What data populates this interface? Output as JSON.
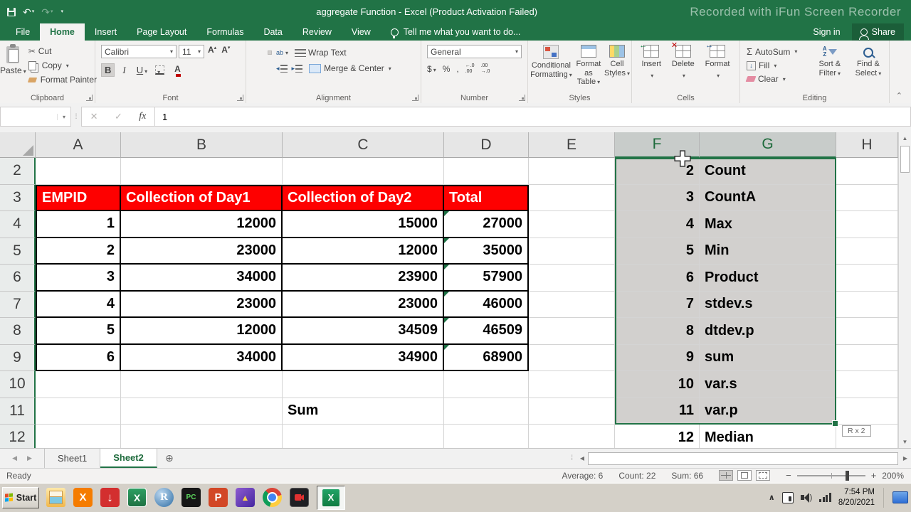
{
  "titlebar": {
    "title": "aggregate Function - Excel (Product Activation Failed)",
    "watermark": "Recorded with iFun Screen Recorder"
  },
  "menu": {
    "tabs": [
      "File",
      "Home",
      "Insert",
      "Page Layout",
      "Formulas",
      "Data",
      "Review",
      "View"
    ],
    "active_tab": "Home",
    "tell_me": "Tell me what you want to do...",
    "sign_in": "Sign in",
    "share": "Share"
  },
  "ribbon": {
    "clipboard": {
      "label": "Clipboard",
      "paste": "Paste",
      "cut": "Cut",
      "copy": "Copy",
      "format_painter": "Format Painter"
    },
    "font": {
      "label": "Font",
      "font_name": "Calibri",
      "font_size": "11"
    },
    "alignment": {
      "label": "Alignment",
      "wrap_text": "Wrap Text",
      "merge_center": "Merge & Center"
    },
    "number": {
      "label": "Number",
      "format": "General"
    },
    "styles": {
      "label": "Styles",
      "conditional": "Conditional Formatting",
      "format_table": "Format as Table",
      "cell_styles": "Cell Styles"
    },
    "cells": {
      "label": "Cells",
      "insert": "Insert",
      "delete": "Delete",
      "format": "Format"
    },
    "editing": {
      "label": "Editing",
      "autosum": "AutoSum",
      "fill": "Fill",
      "clear": "Clear",
      "sort_filter": "Sort & Filter",
      "find_select": "Find & Select"
    }
  },
  "formula_bar": {
    "name_box": "",
    "value": "1"
  },
  "grid": {
    "columns": [
      "A",
      "B",
      "C",
      "D",
      "E",
      "F",
      "G",
      "H"
    ],
    "selected_columns": [
      "F",
      "G"
    ],
    "first_row": 2,
    "last_row": 12,
    "table": {
      "headers": [
        "EMPID",
        "Collection of Day1",
        "Collection of Day2",
        "Total"
      ],
      "rows": [
        [
          "1",
          "12000",
          "15000",
          "27000"
        ],
        [
          "2",
          "23000",
          "12000",
          "35000"
        ],
        [
          "3",
          "34000",
          "23900",
          "57900"
        ],
        [
          "4",
          "23000",
          "23000",
          "46000"
        ],
        [
          "5",
          "12000",
          "34509",
          "46509"
        ],
        [
          "6",
          "34000",
          "34900",
          "68900"
        ]
      ]
    },
    "sum_label": "Sum",
    "fg_list": {
      "numbers": [
        "2",
        "3",
        "4",
        "5",
        "6",
        "7",
        "8",
        "9",
        "10",
        "11",
        "12"
      ],
      "names": [
        "Count",
        "CountA",
        "Max",
        "Min",
        "Product",
        "stdev.s",
        "dtdev.p",
        "sum",
        "var.s",
        "var.p",
        "Median"
      ]
    },
    "selection_tooltip": "R x 2"
  },
  "sheet_bar": {
    "sheets": [
      "Sheet1",
      "Sheet2"
    ],
    "active": "Sheet2"
  },
  "status_bar": {
    "mode": "Ready",
    "average": "Average: 6",
    "count": "Count: 22",
    "sum": "Sum: 66",
    "zoom": "200%"
  },
  "taskbar": {
    "start": "Start",
    "icons": [
      "explorer",
      "xampp",
      "download-manager",
      "excel-old",
      "r",
      "pycharm",
      "powerpoint",
      "photo-app",
      "chrome",
      "screen-recorder"
    ],
    "active_app": "excel",
    "tray_time": "7:54 PM",
    "tray_date": "8/20/2021"
  },
  "colors": {
    "excel_green": "#217346",
    "header_red": "#fe0000"
  }
}
